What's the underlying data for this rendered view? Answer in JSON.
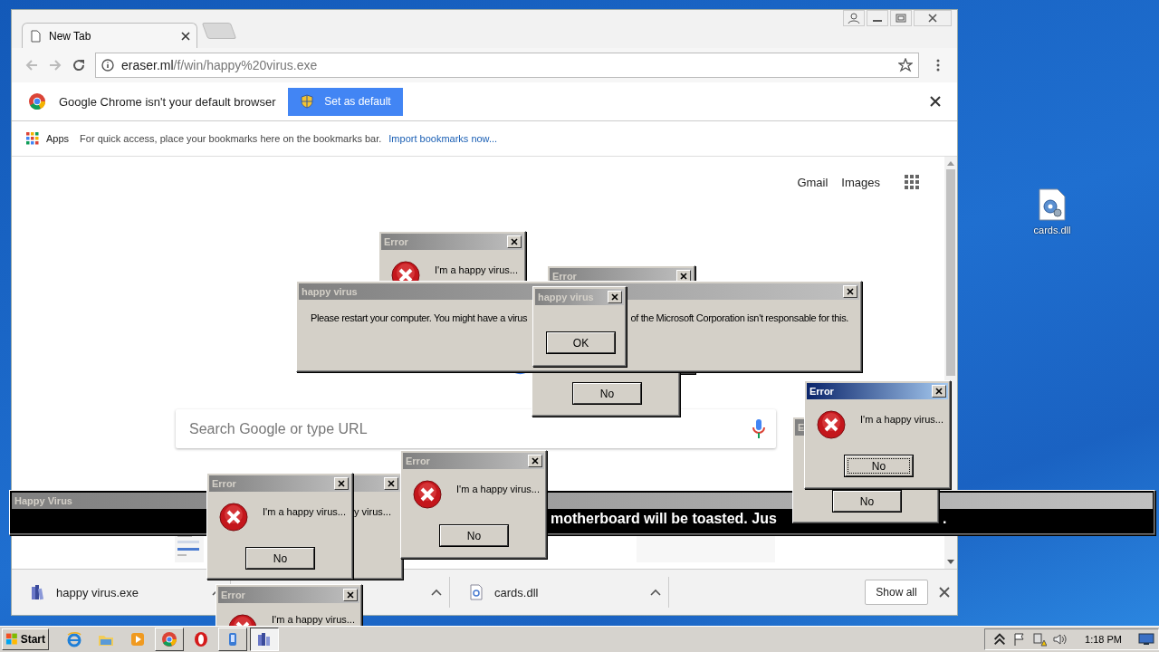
{
  "desktop_icons": [
    {
      "label": "cards.dll"
    }
  ],
  "browser": {
    "tab": {
      "title": "New Tab"
    },
    "address": {
      "host": "eraser.ml",
      "path": "/f/win/happy%20virus.exe"
    },
    "infobar": {
      "message": "Google Chrome isn't your default browser",
      "button": "Set as default"
    },
    "bookmarks_bar": {
      "apps": "Apps",
      "hint": "For quick access, place your bookmarks here on the bookmarks bar.",
      "link": "Import bookmarks now..."
    },
    "header_links": [
      "Gmail",
      "Images"
    ],
    "search": {
      "placeholder": "Search Google or type URL"
    },
    "downloads": [
      {
        "kind": "exe",
        "name": "happy virus.exe"
      },
      {
        "kind": "covered"
      },
      {
        "kind": "dll",
        "name": "cards.dll"
      }
    ],
    "show_all": "Show all"
  },
  "dialogs": [
    {
      "kind": "error",
      "title": "Error",
      "text": "I'm a happy virus...",
      "active": false
    },
    {
      "kind": "error",
      "title": "Error",
      "active": false
    },
    {
      "kind": "error",
      "button": "No",
      "active": false
    },
    {
      "kind": "message",
      "title": "happy virus",
      "texts": [
        "Please restart your computer. You might have a virus",
        "of the Microsoft Corporation isn't responsable for this."
      ],
      "active": false
    },
    {
      "kind": "message",
      "title": "happy virus",
      "button": "OK",
      "active": false
    },
    {
      "kind": "banner",
      "title": "Happy Virus",
      "texts": [
        "motherboard will be toasted. Jus",
        "."
      ],
      "active": false
    },
    {
      "kind": "error",
      "text": "y virus...",
      "active": false
    },
    {
      "kind": "error",
      "title": "Error",
      "text": "I'm a happy virus...",
      "button": "No",
      "active": false
    },
    {
      "kind": "error",
      "title": "Error",
      "text": "I'm a happy virus...",
      "button": "No",
      "active": false
    },
    {
      "kind": "error",
      "title": "Error",
      "text": "I'm a happy virus...",
      "active": false
    },
    {
      "kind": "error",
      "title": "E",
      "button": "No",
      "active": false
    },
    {
      "kind": "error",
      "title": "Error",
      "text": "I'm a happy virus...",
      "button": "No",
      "active": true
    }
  ],
  "taskbar": {
    "start": "Start",
    "apps": [
      {
        "kind": "ie",
        "open": false,
        "active": false
      },
      {
        "kind": "folder",
        "open": false,
        "active": false
      },
      {
        "kind": "media",
        "open": false,
        "active": false
      },
      {
        "kind": "chrome",
        "open": true,
        "active": false
      },
      {
        "kind": "opera",
        "open": false,
        "active": false
      },
      {
        "kind": "app",
        "open": true,
        "active": false
      },
      {
        "kind": "virus",
        "open": true,
        "active": true
      }
    ],
    "clock": "1:18 PM"
  }
}
